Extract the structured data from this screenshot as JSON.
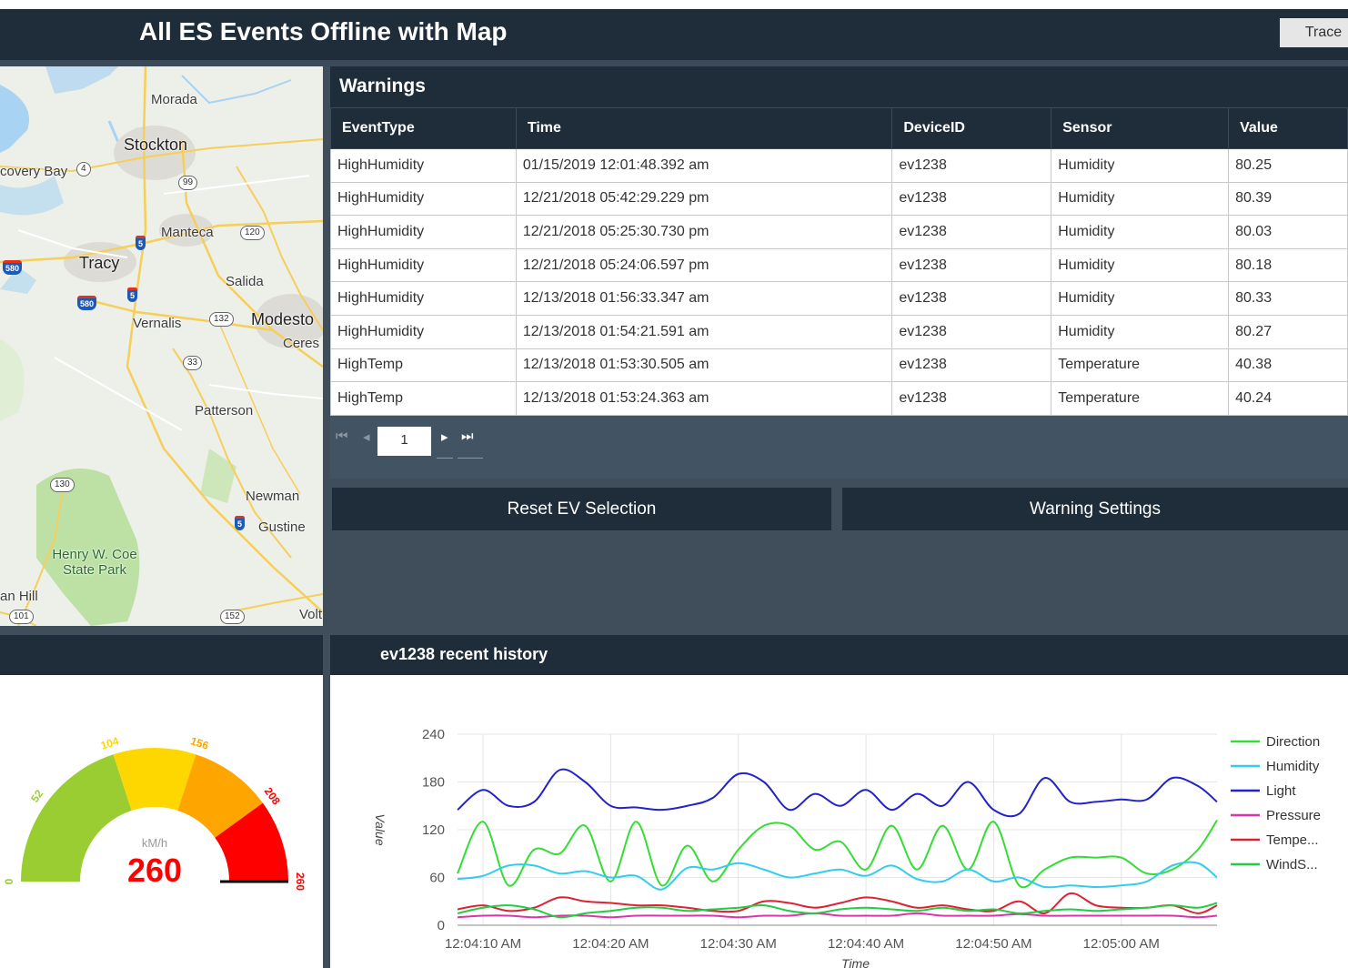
{
  "header": {
    "title": "All ES Events Offline with Map",
    "trace_label": "Trace"
  },
  "map": {
    "places": [
      "Morada",
      "Stockton",
      "covery Bay",
      "Manteca",
      "Tracy",
      "Salida",
      "Vernalis",
      "Modesto",
      "Ceres",
      "Patterson",
      "Newman",
      "Gustine",
      "Henry W. Coe State Park",
      "an Hill",
      "Volt"
    ],
    "shields": [
      "4",
      "99",
      "120",
      "580",
      "5",
      "580",
      "5",
      "132",
      "33",
      "130",
      "5",
      "152",
      "101"
    ]
  },
  "warnings": {
    "title": "Warnings",
    "columns": [
      "EventType",
      "Time",
      "DeviceID",
      "Sensor",
      "Value"
    ],
    "rows": [
      [
        "HighHumidity",
        "01/15/2019 12:01:48.392 am",
        "ev1238",
        "Humidity",
        "80.25"
      ],
      [
        "HighHumidity",
        "12/21/2018 05:42:29.229 pm",
        "ev1238",
        "Humidity",
        "80.39"
      ],
      [
        "HighHumidity",
        "12/21/2018 05:25:30.730 pm",
        "ev1238",
        "Humidity",
        "80.03"
      ],
      [
        "HighHumidity",
        "12/21/2018 05:24:06.597 pm",
        "ev1238",
        "Humidity",
        "80.18"
      ],
      [
        "HighHumidity",
        "12/13/2018 01:56:33.347 am",
        "ev1238",
        "Humidity",
        "80.33"
      ],
      [
        "HighHumidity",
        "12/13/2018 01:54:21.591 am",
        "ev1238",
        "Humidity",
        "80.27"
      ],
      [
        "HighTemp",
        "12/13/2018 01:53:30.505 am",
        "ev1238",
        "Temperature",
        "40.38"
      ],
      [
        "HighTemp",
        "12/13/2018 01:53:24.363 am",
        "ev1238",
        "Temperature",
        "40.24"
      ]
    ],
    "pager": {
      "page": "1",
      "first": "⏮",
      "prev": "◂",
      "next": "▸",
      "last": "⏭"
    }
  },
  "actions": {
    "reset_label": "Reset EV Selection",
    "settings_label": "Warning Settings"
  },
  "gauge": {
    "unit": "kM/h",
    "value": 260,
    "value_text": "260",
    "min": 0,
    "max": 260,
    "ticks": [
      "0",
      "52",
      "104",
      "156",
      "208",
      "260"
    ],
    "colors": {
      "green": "#9acd32",
      "yellow": "#ffd700",
      "orange": "#ffa500",
      "red": "#ff0000"
    }
  },
  "chart_panel_title": "ev1238 recent history",
  "chart_data": {
    "type": "line",
    "title": "",
    "xlabel": "Time",
    "ylabel": "Value",
    "ylim": [
      0,
      240
    ],
    "yticks": [
      "0",
      "60",
      "120",
      "180",
      "240"
    ],
    "x_tick_labels": [
      "12:04:10 AM",
      "12:04:20 AM",
      "12:04:30 AM",
      "12:04:40 AM",
      "12:04:50 AM",
      "12:05:00 AM"
    ],
    "x_ticks_seconds": [
      10,
      20,
      30,
      40,
      50,
      60
    ],
    "xlim_seconds": [
      8,
      67.5
    ],
    "x": [
      8,
      10,
      12,
      14,
      16,
      18,
      20,
      22,
      24,
      26,
      28,
      30,
      32,
      34,
      36,
      38,
      40,
      42,
      44,
      46,
      48,
      50,
      52,
      54,
      56,
      58,
      60,
      62,
      64,
      66,
      67.5
    ],
    "series": [
      {
        "name": "Direction",
        "color": "#33dd33",
        "values": [
          65,
          130,
          50,
          95,
          90,
          125,
          55,
          130,
          50,
          100,
          55,
          95,
          125,
          125,
          95,
          105,
          70,
          125,
          70,
          125,
          70,
          130,
          50,
          70,
          85,
          85,
          85,
          65,
          70,
          95,
          132
        ]
      },
      {
        "name": "Humidity",
        "color": "#33ccee",
        "values": [
          58,
          62,
          75,
          75,
          65,
          68,
          60,
          62,
          45,
          72,
          70,
          78,
          70,
          60,
          65,
          70,
          62,
          75,
          58,
          55,
          70,
          55,
          60,
          48,
          50,
          48,
          50,
          55,
          75,
          78,
          60
        ]
      },
      {
        "name": "Light",
        "color": "#2222cc",
        "values": [
          145,
          170,
          150,
          155,
          195,
          180,
          150,
          148,
          145,
          150,
          160,
          190,
          180,
          145,
          165,
          150,
          170,
          145,
          165,
          150,
          180,
          145,
          140,
          185,
          155,
          155,
          158,
          158,
          185,
          175,
          155
        ]
      },
      {
        "name": "Pressure",
        "color": "#dd33aa",
        "values": [
          10,
          12,
          12,
          10,
          12,
          12,
          10,
          12,
          12,
          12,
          12,
          10,
          12,
          12,
          15,
          12,
          12,
          12,
          15,
          12,
          12,
          12,
          14,
          12,
          12,
          12,
          12,
          12,
          12,
          10,
          12
        ]
      },
      {
        "name": "Tempe...",
        "color": "#dd2233",
        "values": [
          20,
          25,
          18,
          22,
          35,
          30,
          28,
          25,
          25,
          22,
          18,
          18,
          30,
          28,
          22,
          28,
          35,
          30,
          22,
          25,
          20,
          18,
          30,
          15,
          40,
          25,
          22,
          22,
          25,
          15,
          25
        ]
      },
      {
        "name": "WindS...",
        "color": "#22cc44",
        "values": [
          15,
          22,
          25,
          20,
          10,
          15,
          18,
          22,
          22,
          18,
          20,
          22,
          25,
          18,
          15,
          20,
          22,
          20,
          18,
          22,
          18,
          20,
          15,
          18,
          20,
          18,
          20,
          22,
          25,
          22,
          28
        ]
      }
    ],
    "legend": "right"
  }
}
